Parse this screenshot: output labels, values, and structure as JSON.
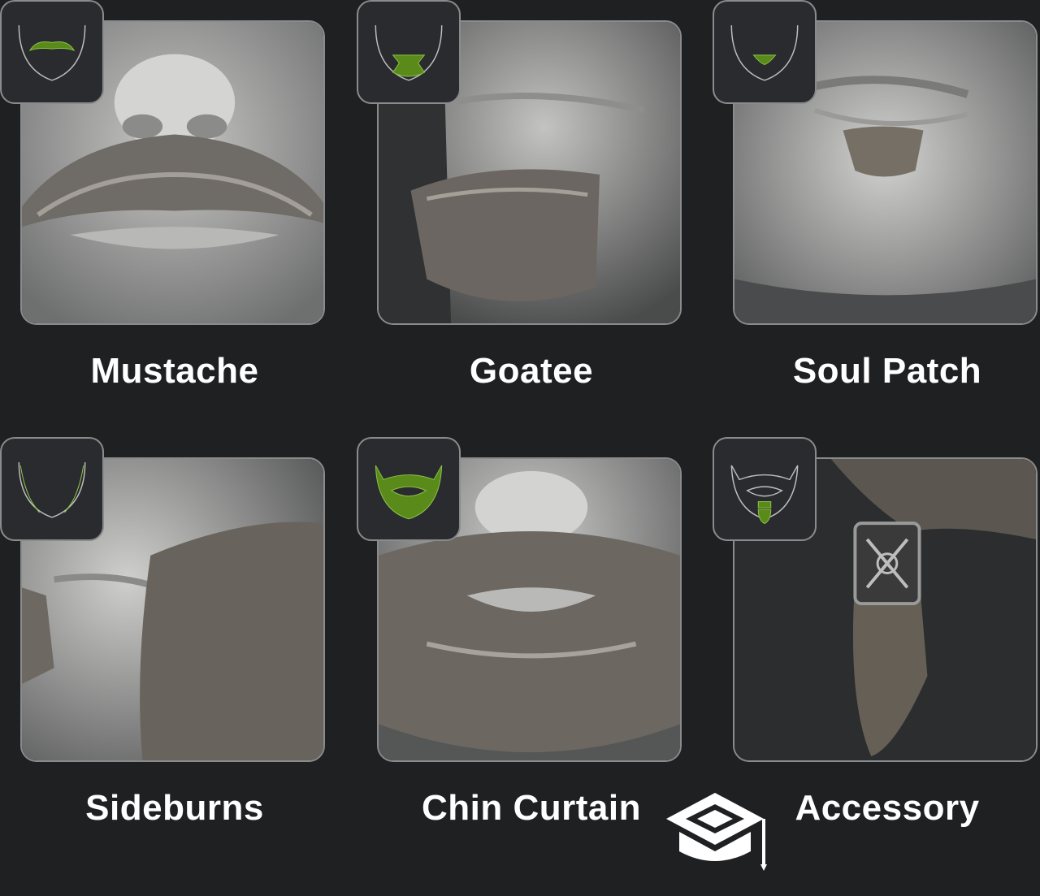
{
  "styles": [
    {
      "label": "Mustache"
    },
    {
      "label": "Goatee"
    },
    {
      "label": "Soul Patch"
    },
    {
      "label": "Sideburns"
    },
    {
      "label": "Chin Curtain"
    },
    {
      "label": "Accessory"
    }
  ],
  "colors": {
    "background": "#1f2022",
    "accent_green": "#5a8a1a",
    "frame_border": "#8a8b8d"
  },
  "icons": [
    "mustache-icon",
    "goatee-icon",
    "soul-patch-icon",
    "sideburns-icon",
    "chin-curtain-icon",
    "accessory-icon",
    "graduation-cap-logo-icon"
  ]
}
